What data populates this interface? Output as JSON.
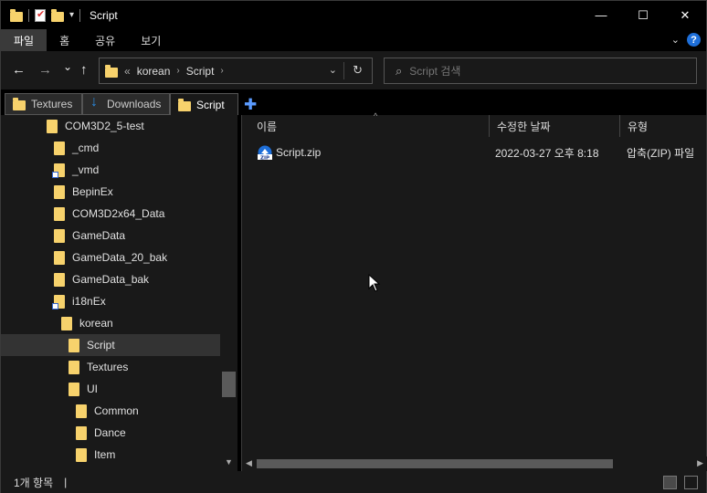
{
  "window": {
    "title": "Script",
    "controls": {
      "minimize": "—",
      "maximize": "☐",
      "close": "✕"
    }
  },
  "ribbon": {
    "tabs": [
      "파일",
      "홈",
      "공유",
      "보기"
    ],
    "active_index": 0,
    "expand_icon": "chevron-down-icon",
    "help_label": "?"
  },
  "navigation": {
    "back": "←",
    "forward": "→",
    "recent": "⌄",
    "up": "↑",
    "address": {
      "overflow": "«",
      "segments": [
        "korean",
        "Script"
      ],
      "chevron": "›"
    },
    "search": {
      "placeholder": "Script 검색"
    }
  },
  "folder_tabs": {
    "tabs": [
      {
        "label": "Textures",
        "icon": "folder-icon"
      },
      {
        "label": "Downloads",
        "icon": "download-icon"
      },
      {
        "label": "Script",
        "icon": "folder-icon"
      }
    ],
    "active_index": 2,
    "add_label": "✚"
  },
  "tree": {
    "items": [
      {
        "label": "COM3D2_5-test",
        "indent": 0,
        "shortcut": false
      },
      {
        "label": "_cmd",
        "indent": 1,
        "shortcut": false
      },
      {
        "label": "_vmd",
        "indent": 1,
        "shortcut": true
      },
      {
        "label": "BepinEx",
        "indent": 1,
        "shortcut": false
      },
      {
        "label": "COM3D2x64_Data",
        "indent": 1,
        "shortcut": false
      },
      {
        "label": "GameData",
        "indent": 1,
        "shortcut": false
      },
      {
        "label": "GameData_20_bak",
        "indent": 1,
        "shortcut": false
      },
      {
        "label": "GameData_bak",
        "indent": 1,
        "shortcut": false
      },
      {
        "label": "i18nEx",
        "indent": 1,
        "shortcut": true
      },
      {
        "label": "korean",
        "indent": 2,
        "shortcut": false
      },
      {
        "label": "Script",
        "indent": 3,
        "shortcut": false,
        "selected": true
      },
      {
        "label": "Textures",
        "indent": 3,
        "shortcut": false
      },
      {
        "label": "UI",
        "indent": 3,
        "shortcut": false
      },
      {
        "label": "Common",
        "indent": 4,
        "shortcut": false
      },
      {
        "label": "Dance",
        "indent": 4,
        "shortcut": false
      },
      {
        "label": "Item",
        "indent": 4,
        "shortcut": false
      }
    ]
  },
  "content": {
    "columns": [
      "이름",
      "수정한 날짜",
      "유형"
    ],
    "files": [
      {
        "name": "Script.zip",
        "modified": "2022-03-27 오후 8:18",
        "type": "압축(ZIP) 파일",
        "icon": "zip-icon"
      }
    ]
  },
  "status": {
    "item_count": "1개 항목",
    "separator": "|"
  },
  "colors": {
    "folder": "#f7d26c",
    "accent": "#1e6fd9",
    "background": "#191919",
    "chrome": "#000000"
  }
}
